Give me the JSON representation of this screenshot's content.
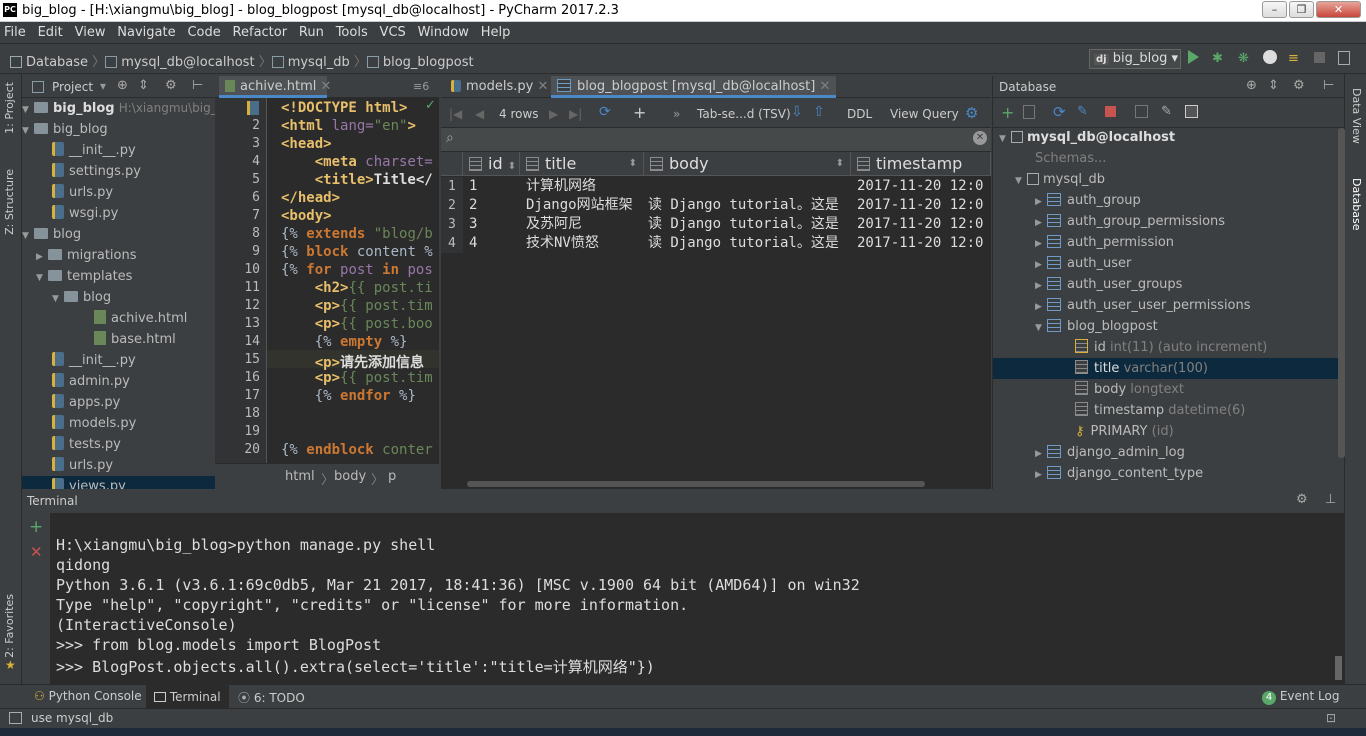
{
  "window": {
    "title": "big_blog - [H:\\xiangmu\\big_blog] - blog_blogpost [mysql_db@localhost] - PyCharm 2017.2.3",
    "app_icon": "PC"
  },
  "menu": [
    "File",
    "Edit",
    "View",
    "Navigate",
    "Code",
    "Refactor",
    "Run",
    "Tools",
    "VCS",
    "Window",
    "Help"
  ],
  "breadcrumbs": [
    "Database",
    "mysql_db@localhost",
    "mysql_db",
    "blog_blogpost"
  ],
  "run_config": "big_blog",
  "side_tabs": {
    "project": "1: Project",
    "structure": "Z: Structure",
    "favorites": "2: Favorites",
    "data_view": "Data View",
    "database": "Database"
  },
  "project": {
    "label": "Project",
    "root_name": "big_blog",
    "root_path": "H:\\xiangmu\\big_blog",
    "items": [
      {
        "name": "big_blog",
        "type": "folder"
      },
      {
        "name": "__init__.py",
        "type": "py"
      },
      {
        "name": "settings.py",
        "type": "py"
      },
      {
        "name": "urls.py",
        "type": "py"
      },
      {
        "name": "wsgi.py",
        "type": "py"
      },
      {
        "name": "blog",
        "type": "folder"
      },
      {
        "name": "migrations",
        "type": "folder"
      },
      {
        "name": "templates",
        "type": "folder"
      },
      {
        "name": "blog",
        "type": "folder"
      },
      {
        "name": "achive.html",
        "type": "html"
      },
      {
        "name": "base.html",
        "type": "html"
      },
      {
        "name": "__init__.py",
        "type": "py"
      },
      {
        "name": "admin.py",
        "type": "py"
      },
      {
        "name": "apps.py",
        "type": "py"
      },
      {
        "name": "models.py",
        "type": "py"
      },
      {
        "name": "tests.py",
        "type": "py"
      },
      {
        "name": "urls.py",
        "type": "py"
      },
      {
        "name": "views.py",
        "type": "py"
      }
    ]
  },
  "editor": {
    "tab": "achive.html",
    "tab_count": "6",
    "line_numbers": [
      "1",
      "2",
      "3",
      "4",
      "5",
      "6",
      "7",
      "8",
      "9",
      "10",
      "11",
      "12",
      "13",
      "14",
      "15",
      "16",
      "17",
      "18",
      "19",
      "20"
    ],
    "lines": {
      "l1": "<!DOCTYPE html>",
      "l2a": "<html",
      "l2b": " lang=",
      "l2c": "\"en\"",
      "l2d": ">",
      "l3": "<head>",
      "l4a": "    <meta",
      "l4b": " charset=",
      "l5a": "    <title>",
      "l5b": "Title</",
      "l6": "</head>",
      "l7": "<body>",
      "l8a": "{% ",
      "l8b": "extends",
      "l8c": " \"blog/b",
      "l9a": "{% ",
      "l9b": "block",
      "l9c": " content %",
      "l10a": "{% ",
      "l10b": "for",
      "l10c": " post ",
      "l10d": "in",
      "l10e": " pos",
      "l11a": "    <h2>",
      "l11b": "{{ post.ti",
      "l12a": "    <p>",
      "l12b": "{{ post.tim",
      "l13a": "    <p>",
      "l13b": "{{ post.boo",
      "l14a": "    {% ",
      "l14b": "empty",
      "l14c": " %}",
      "l15a": "    <p>",
      "l15b": "请先添加信息",
      "l16a": "    <p>",
      "l16b": "{{ post.tim",
      "l17a": "    {% ",
      "l17b": "endfor",
      "l17c": " %}",
      "l20a": "{% ",
      "l20b": "endblock",
      "l20c": " conter"
    },
    "crumbs": [
      "html",
      "body",
      "p"
    ]
  },
  "data_editor": {
    "tabs": [
      "models.py",
      "blog_blogpost [mysql_db@localhost]"
    ],
    "rows_label": "4 rows",
    "format": "Tab-se...d (TSV)",
    "ddl": "DDL",
    "view_query": "View Query",
    "columns": [
      "id",
      "title",
      "body",
      "timestamp"
    ],
    "rows": [
      {
        "n": "1",
        "id": "1",
        "title": "计算机网络",
        "body": "",
        "timestamp": "2017-11-20 12:0"
      },
      {
        "n": "2",
        "id": "2",
        "title": "Django网站框架",
        "body": "读 Django tutorial。这是",
        "timestamp": "2017-11-20 12:0"
      },
      {
        "n": "3",
        "id": "3",
        "title": "及苏阿尼",
        "body": "读 Django tutorial。这是",
        "timestamp": "2017-11-20 12:0"
      },
      {
        "n": "4",
        "id": "4",
        "title": "技术NV愤怒",
        "body": "读 Django tutorial。这是",
        "timestamp": "2017-11-20 12:0"
      }
    ]
  },
  "database": {
    "label": "Database",
    "source": "mysql_db@localhost",
    "schemas": "Schemas...",
    "schema": "mysql_db",
    "tables": [
      "auth_group",
      "auth_group_permissions",
      "auth_permission",
      "auth_user",
      "auth_user_groups",
      "auth_user_user_permissions",
      "blog_blogpost"
    ],
    "columns": [
      {
        "name": "id",
        "type": "int(11) (auto increment)"
      },
      {
        "name": "title",
        "type": "varchar(100)"
      },
      {
        "name": "body",
        "type": "longtext"
      },
      {
        "name": "timestamp",
        "type": "datetime(6)"
      }
    ],
    "key": {
      "name": "PRIMARY",
      "type": "(id)"
    },
    "more_tables": [
      "django_admin_log",
      "django_content_type"
    ]
  },
  "terminal": {
    "label": "Terminal",
    "lines": [
      "H:\\xiangmu\\big_blog>python manage.py shell",
      "qidong",
      "Python 3.6.1 (v3.6.1:69c0db5, Mar 21 2017, 18:41:36) [MSC v.1900 64 bit (AMD64)] on win32",
      "Type \"help\", \"copyright\", \"credits\" or \"license\" for more information.",
      "(InteractiveConsole)",
      ">>> from blog.models import BlogPost",
      ">>> BlogPost.objects.all().extra(select='title':\"title=计算机网络\"})"
    ]
  },
  "bottom_tabs": {
    "python_console": "Python Console",
    "terminal": "Terminal",
    "todo": "6: TODO",
    "event_log": "Event Log",
    "event_count": "4"
  },
  "status": "use mysql_db"
}
